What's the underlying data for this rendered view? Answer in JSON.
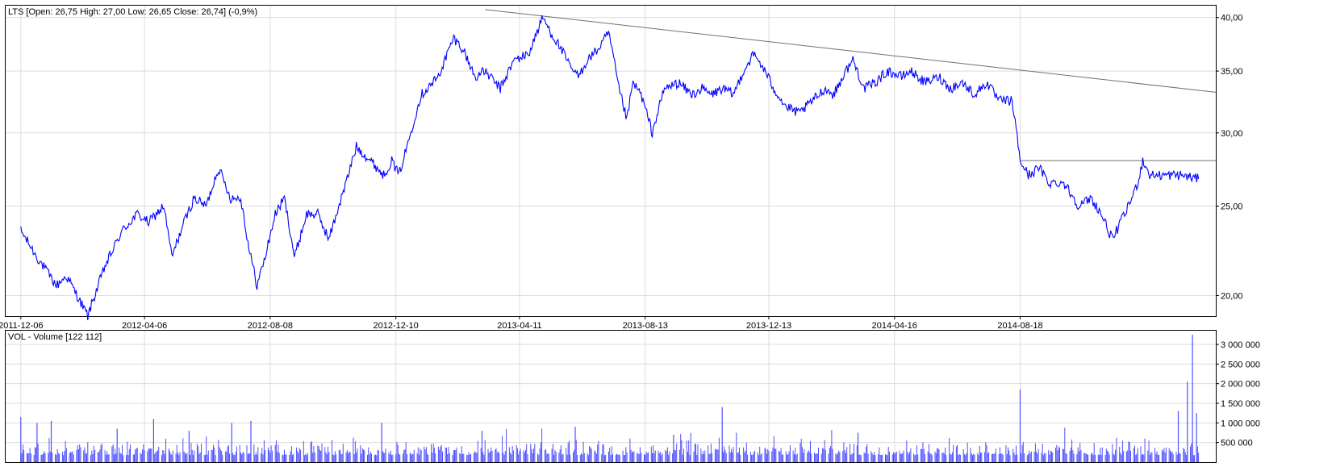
{
  "price_panel": {
    "header": "LTS [Open: 26,75  High: 27,00  Low: 26,65  Close: 26,74] (-0,9%)"
  },
  "volume_panel": {
    "header": "VOL - Volume [122 112]"
  },
  "colors": {
    "series": "#0000ff",
    "volume": "#5050ff",
    "trendline": "#707070",
    "grid": "#dcdcdc",
    "frame": "#000000"
  },
  "chart_data": [
    {
      "type": "line",
      "title": "LTS [Open: 26,75  High: 27,00  Low: 26,65  Close: 26,74] (-0,9%)",
      "scale": "log",
      "ylim": [
        19.0,
        41.2
      ],
      "xlim": [
        "2011-11-21",
        "2015-02-27"
      ],
      "y_ticks": [
        "20,00",
        "25,00",
        "30,00",
        "35,00",
        "40,00"
      ],
      "y_tick_values": [
        20,
        25,
        30,
        35,
        40
      ],
      "x_ticks": [
        "2011-12-06",
        "2012-04-06",
        "2012-08-08",
        "2012-12-10",
        "2013-04-11",
        "2013-08-13",
        "2013-12-13",
        "2014-04-16",
        "2014-08-18"
      ],
      "grid": true,
      "series": [
        {
          "name": "LTS",
          "x": [
            "2011-12-06",
            "2011-12-22",
            "2012-01-10",
            "2012-01-20",
            "2012-02-10",
            "2012-02-27",
            "2012-03-15",
            "2012-03-30",
            "2012-04-10",
            "2012-04-25",
            "2012-05-03",
            "2012-05-15",
            "2012-05-25",
            "2012-06-06",
            "2012-06-18",
            "2012-06-30",
            "2012-07-10",
            "2012-07-18",
            "2012-07-26",
            "2012-08-03",
            "2012-08-13",
            "2012-08-22",
            "2012-09-01",
            "2012-09-13",
            "2012-09-24",
            "2012-10-05",
            "2012-10-22",
            "2012-11-01",
            "2012-11-15",
            "2012-11-28",
            "2012-12-06",
            "2012-12-13",
            "2012-12-21",
            "2012-12-28",
            "2013-01-04",
            "2013-01-21",
            "2013-02-05",
            "2013-02-14",
            "2013-02-26",
            "2013-03-08",
            "2013-03-23",
            "2013-04-06",
            "2013-04-20",
            "2013-05-04",
            "2013-05-12",
            "2013-05-22",
            "2013-05-30",
            "2013-06-08",
            "2013-06-17",
            "2013-06-28",
            "2013-07-08",
            "2013-07-18",
            "2013-07-26",
            "2013-08-01",
            "2013-08-09",
            "2013-08-20",
            "2013-09-01",
            "2013-09-15",
            "2013-09-28",
            "2013-10-08",
            "2013-10-17",
            "2013-10-28",
            "2013-11-08",
            "2013-11-18",
            "2013-11-28",
            "2013-12-06",
            "2013-12-18",
            "2013-12-30",
            "2014-01-12",
            "2014-01-25",
            "2014-02-06",
            "2014-02-15",
            "2014-02-27",
            "2014-03-06",
            "2014-03-17",
            "2014-03-28",
            "2014-04-09",
            "2014-04-23",
            "2014-05-02",
            "2014-05-16",
            "2014-05-30",
            "2014-06-10",
            "2014-06-22",
            "2014-07-04",
            "2014-07-16",
            "2014-07-28",
            "2014-08-10",
            "2014-08-18",
            "2014-08-26",
            "2014-09-06",
            "2014-09-15",
            "2014-09-30",
            "2014-10-15",
            "2014-10-27",
            "2014-11-06",
            "2014-11-17",
            "2014-11-25",
            "2014-12-03",
            "2014-12-12",
            "2014-12-17",
            "2014-12-24",
            "2015-01-08",
            "2015-01-24",
            "2015-02-10"
          ],
          "y": [
            23.5,
            22.0,
            20.5,
            21.0,
            19.0,
            21.5,
            23.5,
            24.5,
            24.0,
            25.0,
            22.0,
            24.0,
            25.5,
            25.0,
            27.5,
            25.5,
            25.5,
            22.5,
            20.5,
            22.0,
            24.5,
            25.5,
            22.0,
            24.5,
            24.5,
            23.0,
            26.5,
            29.0,
            28.0,
            27.0,
            28.0,
            27.0,
            29.0,
            31.0,
            33.0,
            34.5,
            38.0,
            37.0,
            34.5,
            35.0,
            33.5,
            36.0,
            36.5,
            40.0,
            38.5,
            37.0,
            35.5,
            34.5,
            36.0,
            37.0,
            38.5,
            33.5,
            31.0,
            34.0,
            33.0,
            30.0,
            33.5,
            34.0,
            33.0,
            33.5,
            33.0,
            33.5,
            33.0,
            35.0,
            36.5,
            35.5,
            33.5,
            32.0,
            31.5,
            32.5,
            33.5,
            33.0,
            35.0,
            36.0,
            33.5,
            34.0,
            35.0,
            34.5,
            35.0,
            34.0,
            34.5,
            33.5,
            34.0,
            33.0,
            34.0,
            32.5,
            32.5,
            28.0,
            27.0,
            27.5,
            26.5,
            26.5,
            25.0,
            25.5,
            24.5,
            23.0,
            24.0,
            25.0,
            26.5,
            28.0,
            27.0,
            27.0,
            27.0,
            26.74
          ]
        }
      ],
      "annotations": [
        {
          "type": "trendline",
          "from": [
            "2013-03-08",
            40.8
          ],
          "to": [
            "2015-02-27",
            33.2
          ]
        },
        {
          "type": "horizontal",
          "from": "2014-08-18",
          "to": "2015-02-27",
          "value": 28.0
        }
      ]
    },
    {
      "type": "bar",
      "title": "VOL - Volume [122 112]",
      "ylim": [
        0,
        3350000
      ],
      "y_ticks": [
        "500 000",
        "1 000 000",
        "1 500 000",
        "2 000 000",
        "2 500 000",
        "3 000 000"
      ],
      "y_tick_values": [
        500000,
        1000000,
        1500000,
        2000000,
        2500000,
        3000000
      ],
      "grid": true,
      "baseline_volume": [
        180000,
        650000
      ],
      "spikes": [
        {
          "x": "2011-12-06",
          "value": 1150000
        },
        {
          "x": "2011-12-22",
          "value": 1000000
        },
        {
          "x": "2012-01-05",
          "value": 1050000
        },
        {
          "x": "2012-03-10",
          "value": 850000
        },
        {
          "x": "2012-04-15",
          "value": 1100000
        },
        {
          "x": "2012-05-20",
          "value": 800000
        },
        {
          "x": "2012-07-01",
          "value": 1000000
        },
        {
          "x": "2012-07-20",
          "value": 1050000
        },
        {
          "x": "2012-11-26",
          "value": 1000000
        },
        {
          "x": "2013-03-05",
          "value": 800000
        },
        {
          "x": "2013-06-05",
          "value": 900000
        },
        {
          "x": "2013-09-10",
          "value": 700000
        },
        {
          "x": "2013-10-28",
          "value": 1400000
        },
        {
          "x": "2014-03-11",
          "value": 750000
        },
        {
          "x": "2014-08-18",
          "value": 1850000
        },
        {
          "x": "2015-01-21",
          "value": 1300000
        },
        {
          "x": "2015-01-30",
          "value": 2050000
        },
        {
          "x": "2015-02-04",
          "value": 3250000
        },
        {
          "x": "2015-02-08",
          "value": 1250000
        }
      ]
    }
  ]
}
